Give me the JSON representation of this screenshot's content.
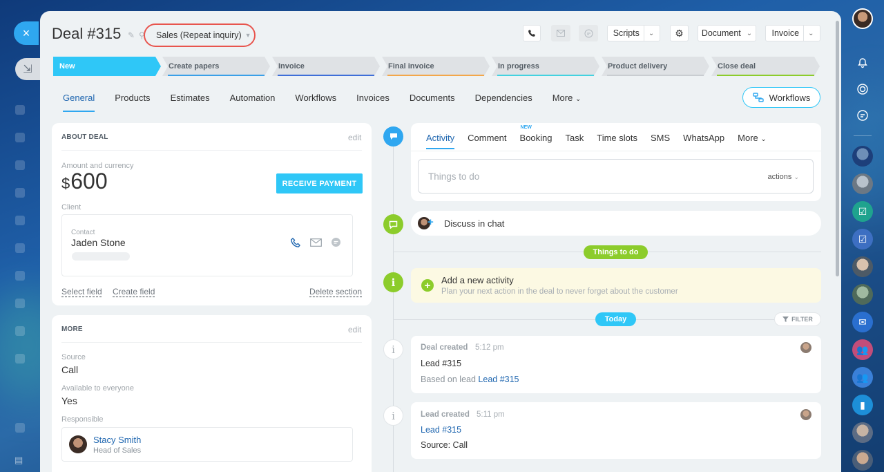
{
  "left_sidebar": {
    "close_icon": "×",
    "minimize_icon": "⇲"
  },
  "deal": {
    "title": "Deal #315",
    "pipeline": "Sales (Repeat inquiry)"
  },
  "header_buttons": {
    "scripts": "Scripts",
    "document": "Document",
    "invoice": "Invoice"
  },
  "stages": [
    {
      "label": "New",
      "color": "#2fc7f7"
    },
    {
      "label": "Create papers",
      "color": "#3aa0e8"
    },
    {
      "label": "Invoice",
      "color": "#3f6fd8"
    },
    {
      "label": "Final invoice",
      "color": "#f3a74a"
    },
    {
      "label": "In progress",
      "color": "#44d2e0"
    },
    {
      "label": "Product delivery",
      "color": "#c9cdd1"
    },
    {
      "label": "Close deal",
      "color": "#8ccc2b"
    }
  ],
  "tabs": [
    "General",
    "Products",
    "Estimates",
    "Automation",
    "Workflows",
    "Invoices",
    "Documents",
    "Dependencies",
    "More"
  ],
  "workflows_button": "Workflows",
  "about": {
    "header": "ABOUT DEAL",
    "edit": "edit",
    "amount_label": "Amount and currency",
    "currency": "$",
    "amount": "600",
    "receive_payment": "RECEIVE PAYMENT",
    "client_label": "Client",
    "contact_label": "Contact",
    "contact_name": "Jaden Stone",
    "select_field": "Select field",
    "create_field": "Create field",
    "delete_section": "Delete section"
  },
  "more": {
    "header": "MORE",
    "edit": "edit",
    "source_label": "Source",
    "source_value": "Call",
    "available_label": "Available to everyone",
    "available_value": "Yes",
    "responsible_label": "Responsible",
    "responsible_name": "Stacy Smith",
    "responsible_title": "Head of Sales"
  },
  "activity": {
    "tabs": [
      "Activity",
      "Comment",
      "Booking",
      "Task",
      "Time slots",
      "SMS",
      "WhatsApp",
      "More"
    ],
    "new_badge": "NEW",
    "placeholder": "Things to do",
    "actions": "actions"
  },
  "timeline": {
    "discuss": "Discuss in chat",
    "things_to_do_pill": "Things to do",
    "add_activity_title": "Add a new activity",
    "add_activity_sub": "Plan your next action in the deal to never forget about the customer",
    "today_pill": "Today",
    "filter": "FILTER",
    "events": [
      {
        "title": "Deal created",
        "time": "5:12 pm",
        "line1": "Lead #315",
        "line2_prefix": "Based on lead",
        "line2_link": "Lead #315"
      },
      {
        "title": "Lead created",
        "time": "5:11 pm",
        "line1": "Lead #315",
        "line2": "Source: Call"
      }
    ]
  }
}
